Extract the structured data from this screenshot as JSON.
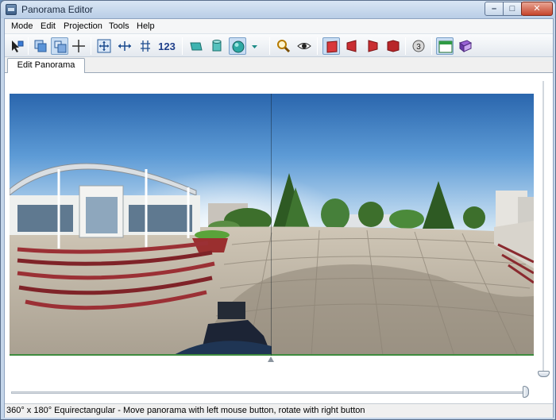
{
  "window": {
    "title": "Panorama Editor",
    "minimize": "–",
    "maximize": "□",
    "close": "✕"
  },
  "menu": [
    "Mode",
    "Edit",
    "Projection",
    "Tools",
    "Help"
  ],
  "toolbar": {
    "number_button": "123",
    "badge_button": "3",
    "icons": [
      "select-arrow-icon",
      "copy-images-icon",
      "move-icon",
      "crosshair-icon",
      "align-center-icon",
      "horizontal-align-icon",
      "vertical-align-icon",
      "number-icon",
      "flat-projection-icon",
      "cylinder-projection-icon",
      "sphere-projection-icon",
      "dropdown-arrow-icon",
      "zoom-icon",
      "preview-eye-icon",
      "red-plane-front-icon",
      "red-plane-left-icon",
      "red-plane-right-icon",
      "red-plane-back-icon",
      "circle-badge-icon",
      "window-layout-icon",
      "book-icon"
    ]
  },
  "tabs": [
    {
      "label": "Edit Panorama",
      "active": true
    }
  ],
  "status": {
    "text": "360° x 180° Equirectangular - Move panorama with left mouse button, rotate with right button"
  },
  "sliders": {
    "vertical_position_percent": 99,
    "horizontal_position_percent": 99
  },
  "colors": {
    "sky_top": "#2e6fb8",
    "sky_light": "#d6e8f5",
    "pavement": "#b7ad9e",
    "trees": "#3b6b2a",
    "steps_red": "#8a2a2f"
  }
}
